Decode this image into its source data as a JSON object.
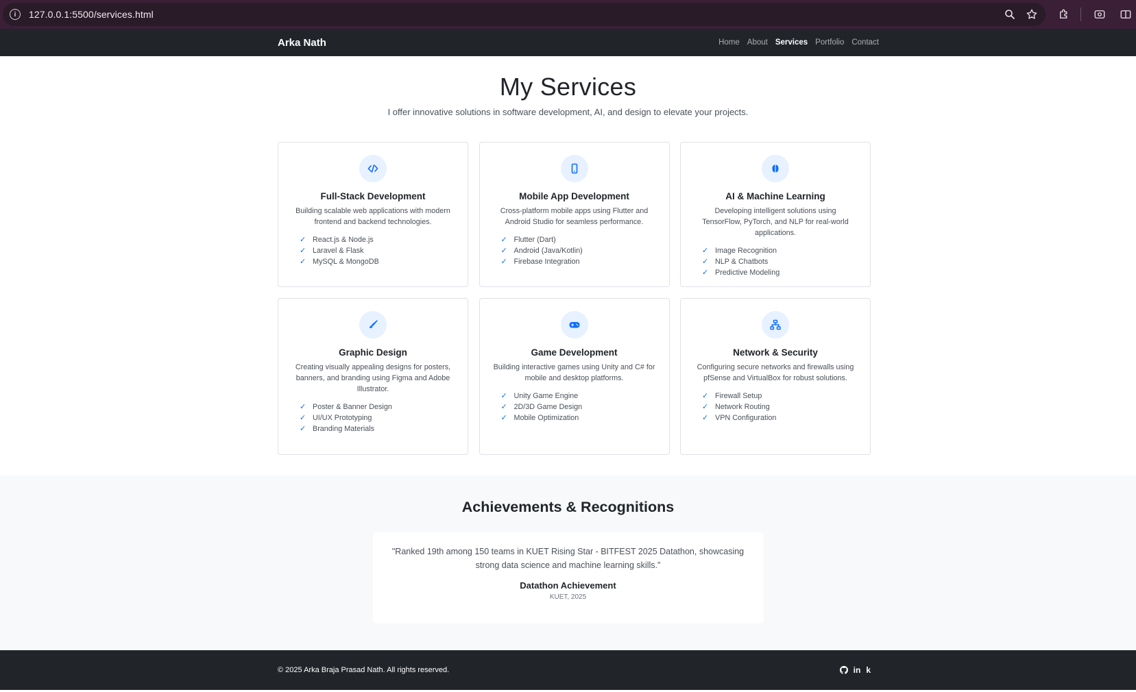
{
  "browser": {
    "url": "127.0.0.1:5500/services.html",
    "icons": [
      "info-icon",
      "zoom-icon",
      "star-icon",
      "extensions-icon",
      "screenshot-icon",
      "reading-mode-icon"
    ]
  },
  "nav": {
    "brand": "Arka Nath",
    "links": [
      "Home",
      "About",
      "Services",
      "Portfolio",
      "Contact"
    ],
    "active": "Services"
  },
  "hero": {
    "title": "My Services",
    "subtitle": "I offer innovative solutions in software development, AI, and design to elevate your projects."
  },
  "services": [
    {
      "icon": "code-icon",
      "title": "Full-Stack Development",
      "description": "Building scalable web applications with modern frontend and backend technologies.",
      "features": [
        "React.js & Node.js",
        "Laravel & Flask",
        "MySQL & MongoDB"
      ]
    },
    {
      "icon": "phone-icon",
      "title": "Mobile App Development",
      "description": "Cross-platform mobile apps using Flutter and Android Studio for seamless performance.",
      "features": [
        "Flutter (Dart)",
        "Android (Java/Kotlin)",
        "Firebase Integration"
      ]
    },
    {
      "icon": "brain-icon",
      "title": "AI & Machine Learning",
      "description": "Developing intelligent solutions using TensorFlow, PyTorch, and NLP for real-world applications.",
      "features": [
        "Image Recognition",
        "NLP & Chatbots",
        "Predictive Modeling"
      ]
    },
    {
      "icon": "brush-icon",
      "title": "Graphic Design",
      "description": "Creating visually appealing designs for posters, banners, and branding using Figma and Adobe Illustrator.",
      "features": [
        "Poster & Banner Design",
        "UI/UX Prototyping",
        "Branding Materials"
      ]
    },
    {
      "icon": "controller-icon",
      "title": "Game Development",
      "description": "Building interactive games using Unity and C# for mobile and desktop platforms.",
      "features": [
        "Unity Game Engine",
        "2D/3D Game Design",
        "Mobile Optimization"
      ]
    },
    {
      "icon": "network-icon",
      "title": "Network & Security",
      "description": "Configuring secure networks and firewalls using pfSense and VirtualBox for robust solutions.",
      "features": [
        "Firewall Setup",
        "Network Routing",
        "VPN Configuration"
      ]
    }
  ],
  "achievements": {
    "title": "Achievements & Recognitions",
    "quote": "\"Ranked 19th among 150 teams in KUET Rising Star - BITFEST 2025 Datathon, showcasing strong data science and machine learning skills.\"",
    "quote_title": "Datathon Achievement",
    "quote_source": "KUET, 2025"
  },
  "footer": {
    "copyright": "© 2025 Arka Braja Prasad Nath. All rights reserved.",
    "socials": [
      "github-icon",
      "linkedin-icon",
      "kaggle-icon"
    ],
    "kaggle_glyph": "k",
    "linkedin_glyph": "in"
  },
  "colors": {
    "accent": "#0d6efd",
    "navbar": "#212529",
    "chrome": "#3a1f37",
    "section_bg": "#f8f9fa"
  }
}
